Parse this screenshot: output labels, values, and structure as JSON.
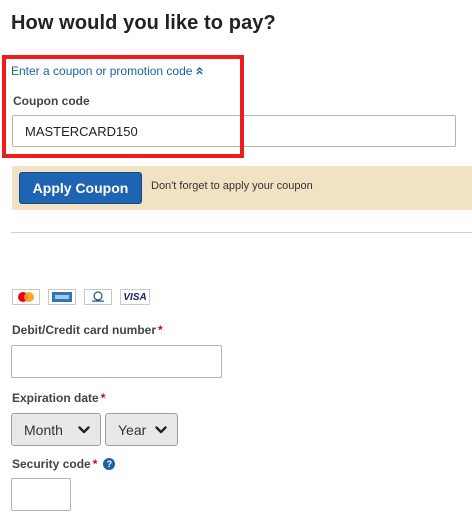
{
  "page": {
    "title": "How would you like to pay?"
  },
  "coupon": {
    "toggle_label": "Enter a coupon or promotion code",
    "toggle_icon": "chevron-double-up-icon",
    "field_label": "Coupon code",
    "value": "MASTERCARD150",
    "apply_button_label": "Apply Coupon",
    "apply_hint": "Don't forget to apply your coupon"
  },
  "card_logos": [
    {
      "name": "mastercard",
      "label": "MasterCard"
    },
    {
      "name": "amex",
      "label": "American Express"
    },
    {
      "name": "diners",
      "label": "Diners Club"
    },
    {
      "name": "visa",
      "label": "VISA"
    }
  ],
  "card_number": {
    "label": "Debit/Credit card number",
    "required_mark": "*",
    "value": ""
  },
  "expiration": {
    "label": "Expiration date",
    "required_mark": "*",
    "month_value": "Month",
    "year_value": "Year"
  },
  "security_code": {
    "label": "Security code",
    "required_mark": "*",
    "help_glyph": "?",
    "value": ""
  },
  "colors": {
    "link": "#1a63a8",
    "primary_button": "#1f64b2",
    "apply_bar": "#f1e2c3",
    "required": "#d0021b",
    "highlight": "#ee1c1c"
  }
}
